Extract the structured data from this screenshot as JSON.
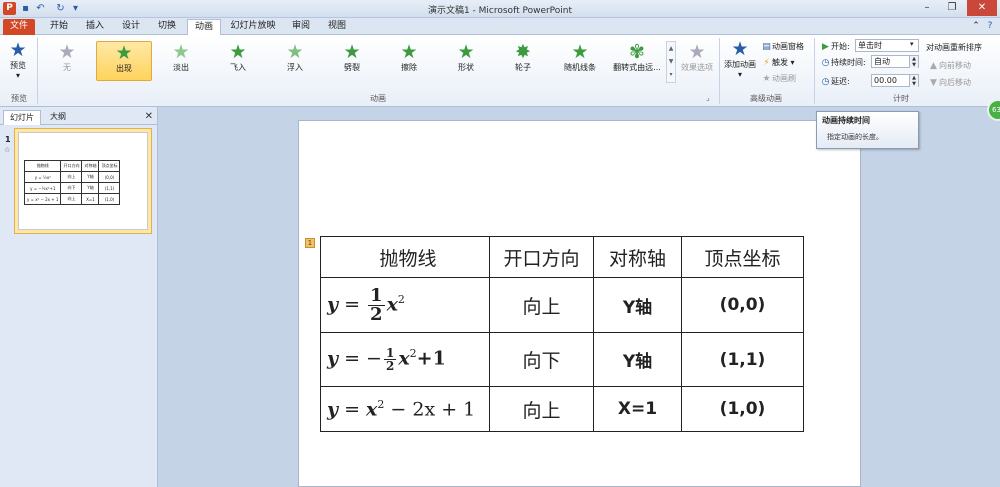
{
  "titlebar": {
    "app_icon": "P",
    "title": "演示文稿1 - Microsoft PowerPoint",
    "qat_icons": [
      "save-icon",
      "undo-icon",
      "redo-icon",
      "customize-icon"
    ]
  },
  "tabs": [
    "文件",
    "开始",
    "插入",
    "设计",
    "切换",
    "动画",
    "幻灯片放映",
    "审阅",
    "视图"
  ],
  "active_tab": "动画",
  "ribbon": {
    "preview": {
      "label": "预览",
      "group": "预览"
    },
    "animations": [
      {
        "label": "无",
        "state": "normal"
      },
      {
        "label": "出现",
        "state": "selected"
      },
      {
        "label": "淡出",
        "state": "normal"
      },
      {
        "label": "飞入",
        "state": "normal"
      },
      {
        "label": "浮入",
        "state": "normal"
      },
      {
        "label": "劈裂",
        "state": "normal"
      },
      {
        "label": "擦除",
        "state": "normal"
      },
      {
        "label": "形状",
        "state": "normal"
      },
      {
        "label": "轮子",
        "state": "normal"
      },
      {
        "label": "随机线条",
        "state": "normal"
      },
      {
        "label": "翻转式由远...",
        "state": "normal"
      }
    ],
    "effect_options": "效果选项",
    "animation_group": "动画",
    "advanced": {
      "add_animation": "添加动画",
      "pane": "动画窗格",
      "trigger": "触发",
      "painter": "动画刷",
      "group": "高级动画"
    },
    "timing": {
      "start_label": "开始:",
      "start_value": "单击时",
      "duration_label": "持续时间:",
      "duration_value": "自动",
      "delay_label": "延迟:",
      "delay_value": "00.00",
      "group": "计时"
    },
    "reorder": {
      "title": "对动画重新排序",
      "earlier": "向前移动",
      "later": "向后移动"
    }
  },
  "tooltip": {
    "title": "动画持续时间",
    "body": "指定动画的长度。"
  },
  "green_badge": "63",
  "side_panel": {
    "tab_slides": "幻灯片",
    "tab_outline": "大纲",
    "slide_number": "1",
    "slide_marker": "☆"
  },
  "anim_tag": "1",
  "table": {
    "headers": [
      "抛物线",
      "开口方向",
      "对称轴",
      "顶点坐标"
    ],
    "rows": [
      {
        "eq": "y = ½x²",
        "dir": "向上",
        "axis": "Y轴",
        "vertex": "(0,0)"
      },
      {
        "eq": "y = −½x²+1",
        "dir": "向下",
        "axis": "Y轴",
        "vertex": "(1,1)"
      },
      {
        "eq": "y = x² − 2x + 1",
        "dir": "向上",
        "axis": "X=1",
        "vertex": "(1,0)"
      }
    ]
  },
  "colors": {
    "file_tab": "#d24726",
    "star": "#3e9a3e",
    "selected": "#ffd35c",
    "workspace": "#c4d3e6"
  }
}
